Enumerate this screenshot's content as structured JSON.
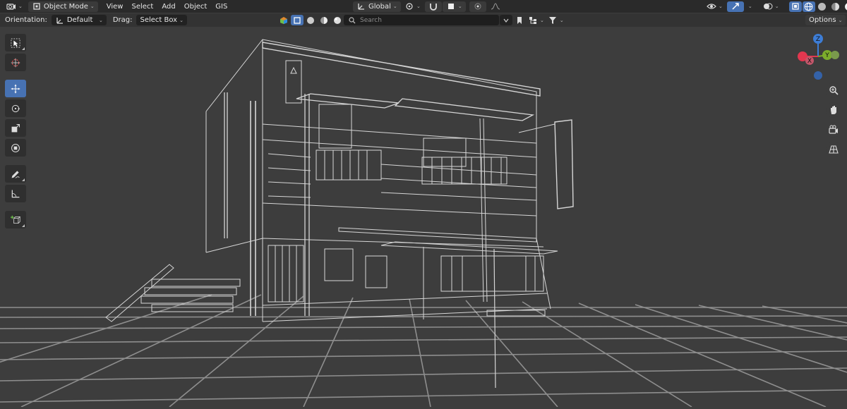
{
  "header": {
    "mode": "Object Mode",
    "menus": [
      "View",
      "Select",
      "Add",
      "Object",
      "GIS"
    ],
    "transform_orientation": "Global"
  },
  "tool_settings": {
    "orientation_label": "Orientation:",
    "orientation_value": "Default",
    "drag_label": "Drag:",
    "drag_value": "Select Box",
    "search_placeholder": "Search",
    "options_label": "Options"
  },
  "toolbar": [
    "select-box",
    "cursor",
    "move",
    "rotate",
    "scale",
    "transform",
    "annotate",
    "measure",
    "add-cube"
  ],
  "gizmo": {
    "x": "X",
    "y": "Y",
    "z": "Z"
  },
  "colors": {
    "accent": "#4772b3",
    "axis_x": "#e2374f",
    "axis_y": "#7cad2b",
    "axis_z": "#3d7dd6"
  }
}
